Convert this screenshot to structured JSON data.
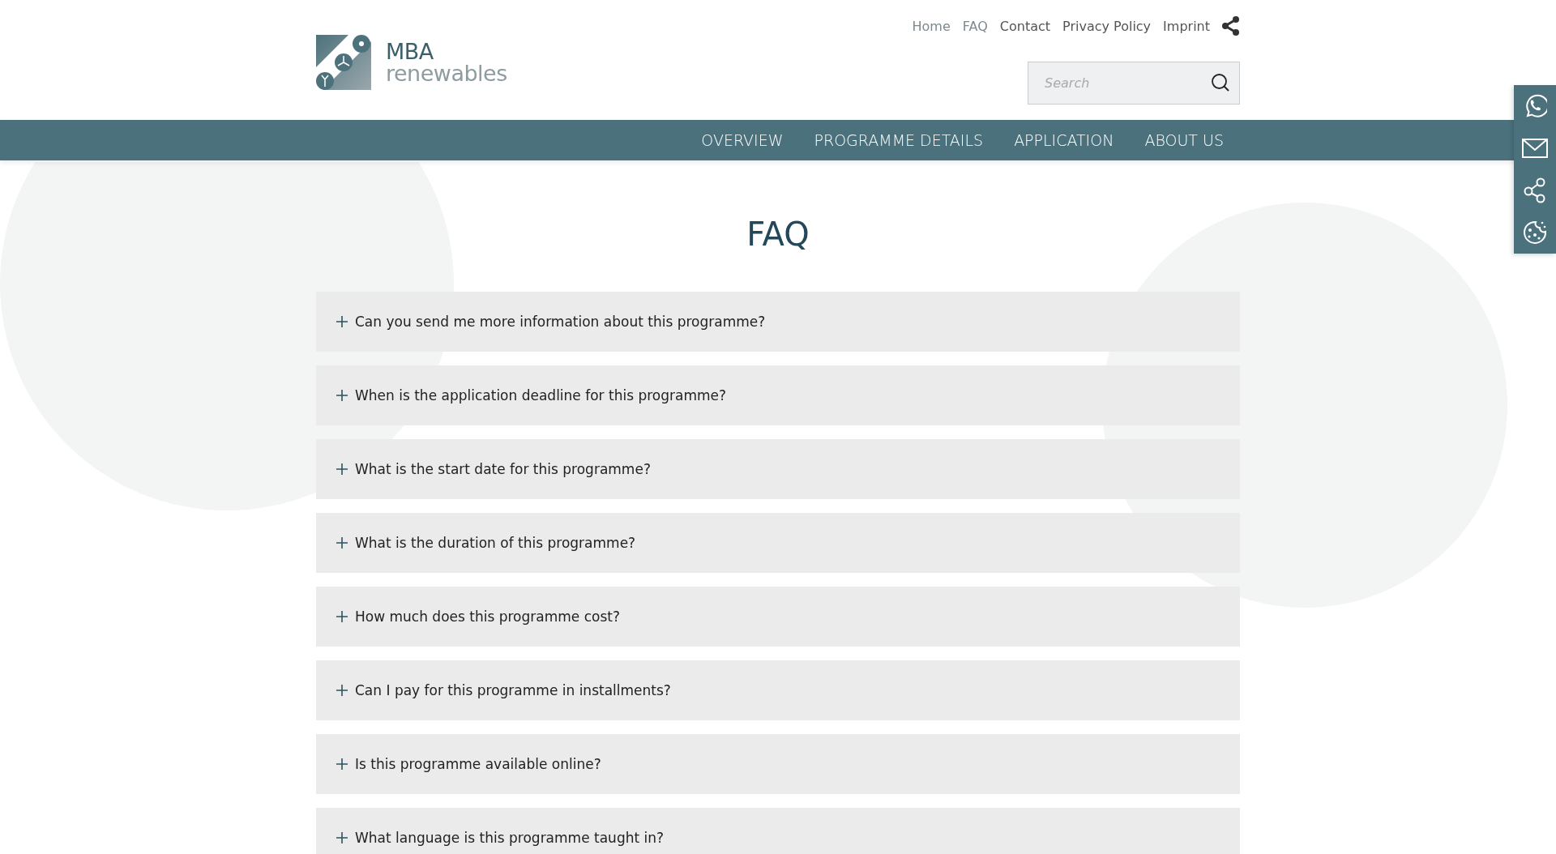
{
  "logo": {
    "line_1": "MBA",
    "line_2": "renewables"
  },
  "top_links": [
    {
      "label": "Home"
    },
    {
      "label": "FAQ"
    },
    {
      "label": "Contact"
    },
    {
      "label": "Privacy Policy"
    },
    {
      "label": "Imprint"
    }
  ],
  "search": {
    "placeholder": "Search"
  },
  "nav": [
    {
      "label": "OVERVIEW"
    },
    {
      "label": "PROGRAMME DETAILS"
    },
    {
      "label": "APPLICATION"
    },
    {
      "label": "ABOUT US"
    }
  ],
  "title": "FAQ",
  "faq": [
    {
      "question": "Can you send me more information about this programme?",
      "expanded": false
    },
    {
      "question": "When is the application deadline for this programme?",
      "expanded": false
    },
    {
      "question": "What is the start date for this programme?",
      "expanded": false
    },
    {
      "question": "What is the duration of this programme?",
      "expanded": false
    },
    {
      "question": "How much does this programme cost?",
      "expanded": false
    },
    {
      "question": "Can I pay for this programme in installments?",
      "expanded": false
    },
    {
      "question": "Is this programme available online?",
      "expanded": false
    },
    {
      "question": "What language is this programme taught in?",
      "expanded": false
    }
  ],
  "side_bar": [
    {
      "kind": "phone"
    },
    {
      "kind": "mail"
    },
    {
      "kind": "share"
    },
    {
      "kind": "cookie"
    }
  ]
}
